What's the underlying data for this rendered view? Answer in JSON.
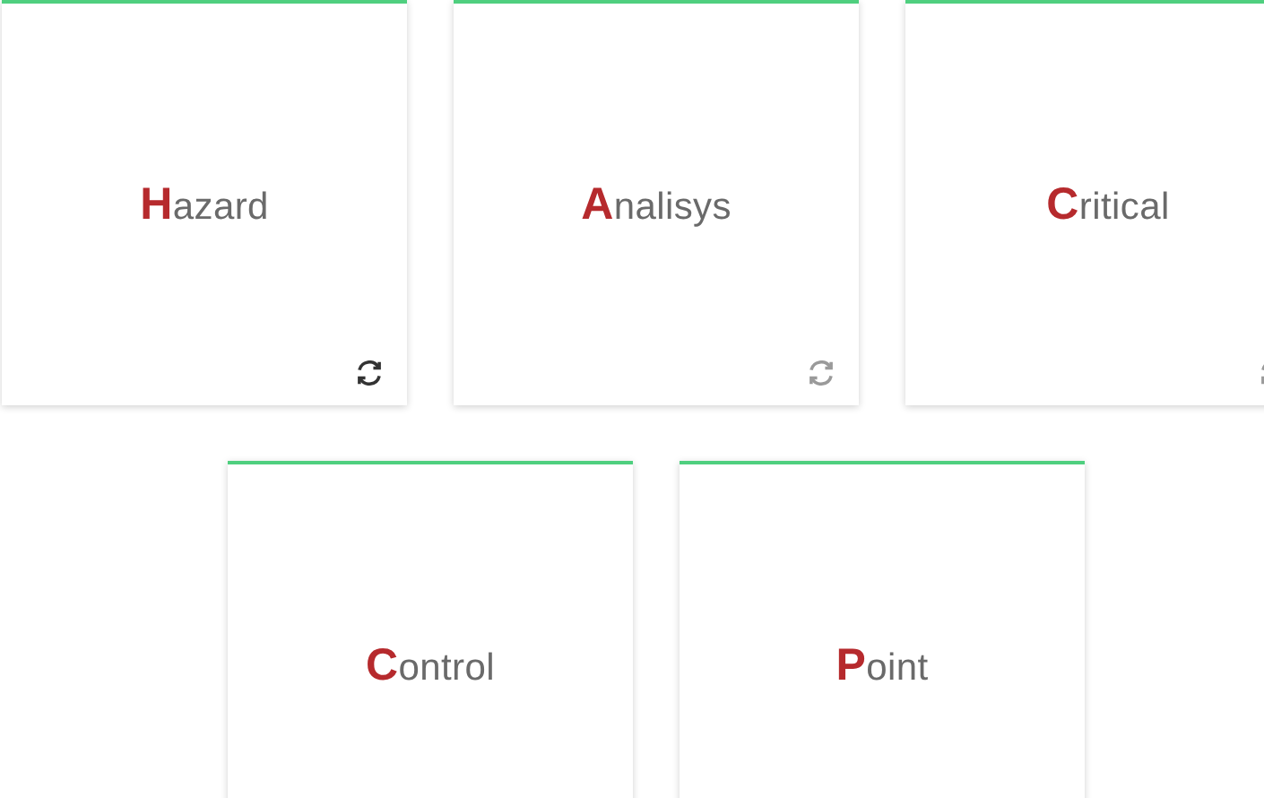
{
  "cards": [
    {
      "word": "**H**azard",
      "icon": true,
      "icon_active": true
    },
    {
      "word": "**A**nalisys",
      "icon": true,
      "icon_active": false
    },
    {
      "word": "**C**ritical",
      "icon": true
    },
    {
      "word": "**C**ontrol"
    },
    {
      "word": "**P**oint"
    }
  ]
}
